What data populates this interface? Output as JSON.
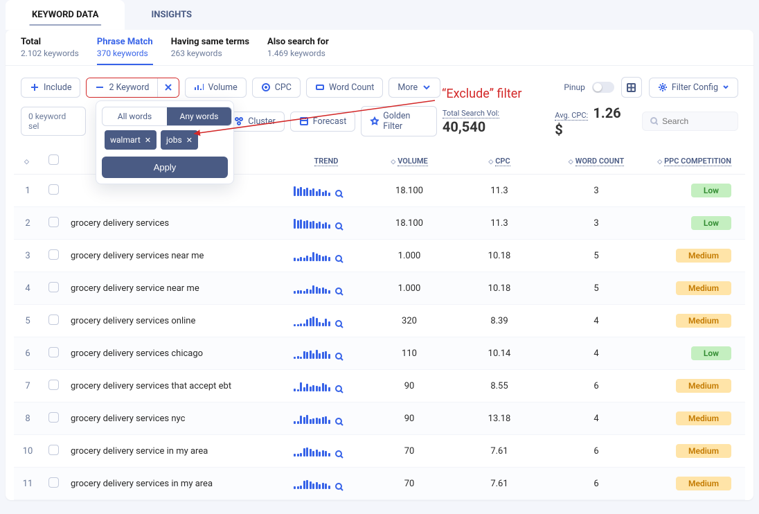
{
  "tabs": {
    "keyword_data": "KEYWORD DATA",
    "insights": "INSIGHTS"
  },
  "stats": {
    "total": {
      "title": "Total",
      "sub": "2.102 keywords"
    },
    "phrase": {
      "title": "Phrase Match",
      "sub": "370 keywords"
    },
    "same_terms": {
      "title": "Having same terms",
      "sub": "263 keywords"
    },
    "also_search": {
      "title": "Also search for",
      "sub": "1.469 keywords"
    }
  },
  "filters": {
    "include": "Include",
    "exclude_count": "2 Keyword",
    "volume": "Volume",
    "cpc": "CPC",
    "word_count": "Word Count",
    "more": "More",
    "pinup": "Pinup",
    "filter_config": "Filter Config"
  },
  "row2": {
    "selected": "0 keyword sel",
    "seg_all": "All words",
    "seg_any": "Any words",
    "cluster": "Cluster",
    "forecast": "Forecast",
    "golden": "Golden Filter",
    "total_vol_lbl": "Total Search Vol:",
    "total_vol_val": "40,540",
    "avg_cpc_lbl": "Avg. CPC:",
    "avg_cpc_val": "1.26 $",
    "search_ph": "Search"
  },
  "dropdown": {
    "chips": [
      "walmart",
      "jobs"
    ],
    "apply": "Apply"
  },
  "annotation": "“Exclude” filter",
  "columns": {
    "trend": "TREND",
    "volume": "VOLUME",
    "cpc": "CPC",
    "wc": "WORD COUNT",
    "ppc": "PPC COMPETITION"
  },
  "badge_labels": {
    "low": "Low",
    "medium": "Medium"
  },
  "rows": [
    {
      "idx": 1,
      "kw": "",
      "vol": "18.100",
      "cpc": "11.3",
      "wc": "3",
      "ppc": "low"
    },
    {
      "idx": 2,
      "kw": "grocery delivery services",
      "vol": "18.100",
      "cpc": "11.3",
      "wc": "3",
      "ppc": "low"
    },
    {
      "idx": 3,
      "kw": "grocery delivery services near me",
      "vol": "1.000",
      "cpc": "10.18",
      "wc": "5",
      "ppc": "medium"
    },
    {
      "idx": 4,
      "kw": "grocery delivery service near me",
      "vol": "1.000",
      "cpc": "10.18",
      "wc": "5",
      "ppc": "medium"
    },
    {
      "idx": 5,
      "kw": "grocery delivery services online",
      "vol": "320",
      "cpc": "8.39",
      "wc": "4",
      "ppc": "medium"
    },
    {
      "idx": 6,
      "kw": "grocery delivery services chicago",
      "vol": "110",
      "cpc": "10.14",
      "wc": "4",
      "ppc": "low"
    },
    {
      "idx": 7,
      "kw": "grocery delivery services that accept ebt",
      "vol": "90",
      "cpc": "8.55",
      "wc": "6",
      "ppc": "medium"
    },
    {
      "idx": 8,
      "kw": "grocery delivery services nyc",
      "vol": "90",
      "cpc": "13.18",
      "wc": "4",
      "ppc": "medium"
    },
    {
      "idx": 10,
      "kw": "grocery delivery service in my area",
      "vol": "70",
      "cpc": "7.61",
      "wc": "6",
      "ppc": "medium"
    },
    {
      "idx": 11,
      "kw": "grocery delivery services in my area",
      "vol": "70",
      "cpc": "7.61",
      "wc": "6",
      "ppc": "medium"
    }
  ],
  "spark_patterns": [
    [
      14,
      11,
      13,
      10,
      12,
      9,
      11,
      7,
      10,
      6,
      8,
      5
    ],
    [
      14,
      12,
      13,
      11,
      12,
      10,
      11,
      8,
      10,
      7,
      9,
      6
    ],
    [
      5,
      4,
      6,
      5,
      8,
      6,
      13,
      11,
      9,
      7,
      8,
      6
    ],
    [
      4,
      5,
      5,
      4,
      7,
      6,
      12,
      10,
      8,
      9,
      7,
      5
    ],
    [
      3,
      3,
      4,
      4,
      10,
      12,
      14,
      12,
      6,
      5,
      11,
      7
    ],
    [
      3,
      4,
      3,
      11,
      10,
      12,
      8,
      13,
      8,
      10,
      11,
      7
    ],
    [
      4,
      3,
      13,
      6,
      11,
      7,
      9,
      8,
      7,
      12,
      10,
      6
    ],
    [
      4,
      4,
      12,
      10,
      13,
      7,
      8,
      9,
      8,
      10,
      11,
      6
    ],
    [
      4,
      4,
      5,
      12,
      13,
      11,
      8,
      10,
      7,
      9,
      8,
      5
    ],
    [
      4,
      4,
      5,
      12,
      13,
      11,
      8,
      10,
      7,
      9,
      8,
      5
    ]
  ]
}
